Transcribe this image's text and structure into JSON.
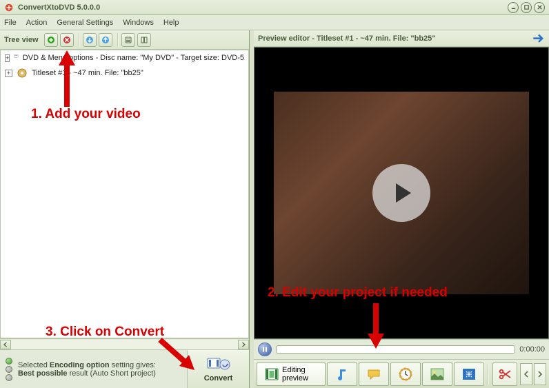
{
  "app": {
    "title": "ConvertXtoDVD 5.0.0.0"
  },
  "menus": {
    "file": "File",
    "action": "Action",
    "general": "General Settings",
    "windows": "Windows",
    "help": "Help"
  },
  "left": {
    "pane_label": "Tree view",
    "tree": {
      "row1": "DVD & Menu options - Disc name: \"My DVD\" - Target size: DVD-5",
      "row2": "Titleset #1 - ~47 min. File: \"bb25\""
    },
    "status_html_1": "Selected ",
    "status_b1": "Encoding option",
    "status_mid": " setting gives: ",
    "status_b2": "Best possible",
    "status_tail": " result (Auto Short project)",
    "convert_label": "Convert"
  },
  "right": {
    "preview_title": "Preview editor - Titleset #1 - ~47 min. File: \"bb25\"",
    "time": "0:00:00",
    "editing_preview": "Editing preview"
  },
  "annotations": {
    "a1": "1. Add your video",
    "a2": "2. Edit your project if needed",
    "a3": "3. Click on Convert"
  }
}
